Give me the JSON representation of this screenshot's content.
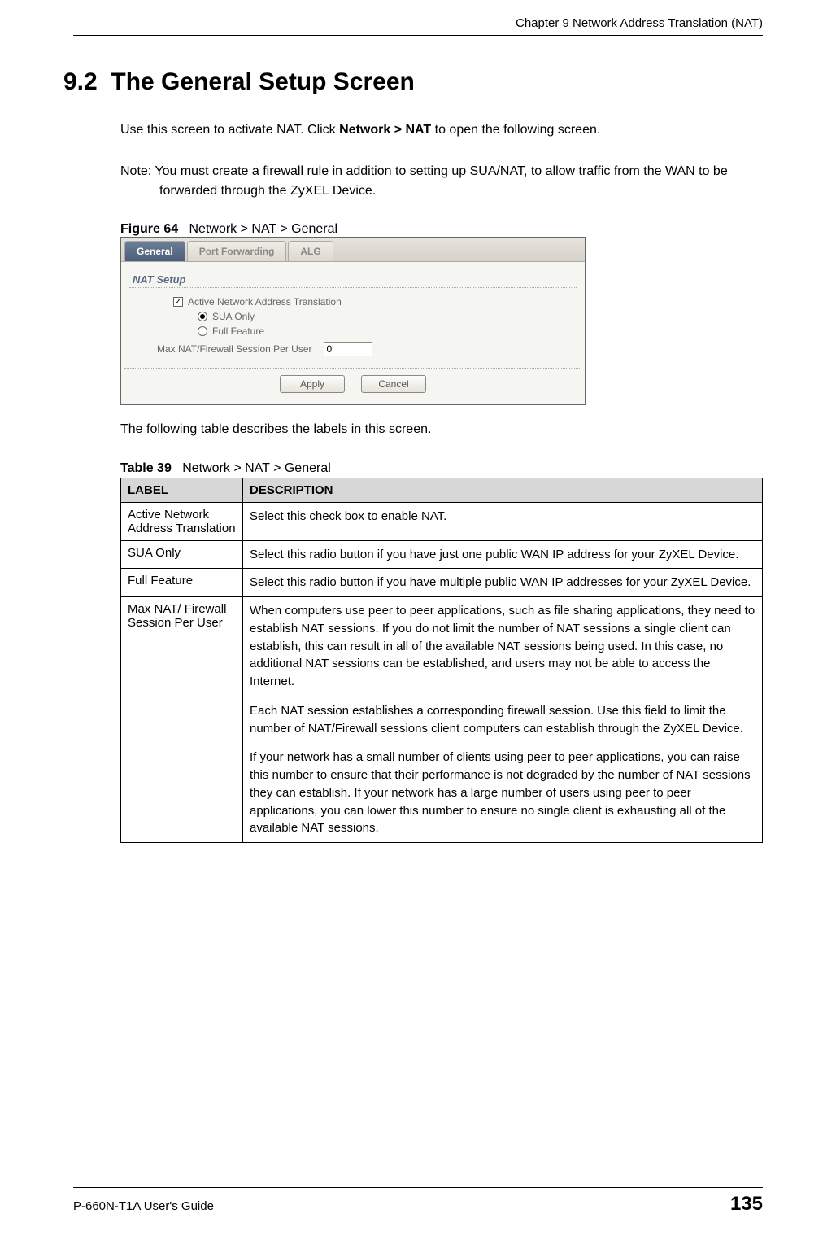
{
  "header": {
    "chapter": "Chapter 9 Network Address Translation (NAT)"
  },
  "section": {
    "number": "9.2",
    "title": "The General Setup Screen"
  },
  "intro_text": "Use this screen to activate NAT. Click Network > NAT to open the following screen.",
  "intro_prefix": "Use this screen to activate NAT. Click ",
  "intro_bold": "Network > NAT",
  "intro_suffix": " to open the following screen.",
  "note": "Note: You must create a firewall rule in addition to setting up SUA/NAT, to allow traffic from the WAN to be forwarded through the ZyXEL Device.",
  "figure": {
    "label": "Figure 64",
    "caption": "Network > NAT > General"
  },
  "screenshot": {
    "tabs": [
      {
        "label": "General",
        "active": true
      },
      {
        "label": "Port Forwarding",
        "active": false
      },
      {
        "label": "ALG",
        "active": false
      }
    ],
    "group_title": "NAT Setup",
    "checkbox_label": "Active Network Address Translation",
    "checkbox_checked": true,
    "radio_options": [
      {
        "label": "SUA Only",
        "selected": true
      },
      {
        "label": "Full Feature",
        "selected": false
      }
    ],
    "session_label": "Max NAT/Firewall Session Per User",
    "session_value": "0",
    "buttons": {
      "apply": "Apply",
      "cancel": "Cancel"
    }
  },
  "before_table_text": "The following table describes the labels in this screen.",
  "table": {
    "label": "Table 39",
    "caption": "Network > NAT > General",
    "headers": {
      "label": "LABEL",
      "description": "DESCRIPTION"
    },
    "rows": [
      {
        "label": "Active Network Address Translation",
        "desc": [
          "Select this check box to enable NAT."
        ]
      },
      {
        "label": "SUA Only",
        "desc": [
          "Select this radio button if you have just one public WAN IP address for your ZyXEL Device."
        ]
      },
      {
        "label": "Full Feature",
        "desc": [
          "Select this radio button if you have multiple public WAN IP addresses for your ZyXEL Device."
        ]
      },
      {
        "label": "Max NAT/ Firewall Session Per User",
        "desc": [
          "When computers use peer to peer applications, such as file sharing applications, they need to establish NAT sessions. If you do not limit the number of NAT sessions a single client can establish, this can result in all of the available NAT sessions being used. In this case, no additional NAT sessions can be established, and users may not be able to access the Internet.",
          "Each NAT session establishes a corresponding firewall session. Use this field to limit the number of NAT/Firewall sessions client computers can establish through the ZyXEL Device.",
          "If your network has a small number of clients using peer to peer applications, you can raise this number to ensure that their performance is not degraded by the number of NAT sessions they can establish. If your network has a large number of users using peer to peer applications, you can lower this number to ensure no single client is exhausting all of the available NAT sessions."
        ]
      }
    ]
  },
  "footer": {
    "guide": "P-660N-T1A User's Guide",
    "page": "135"
  }
}
